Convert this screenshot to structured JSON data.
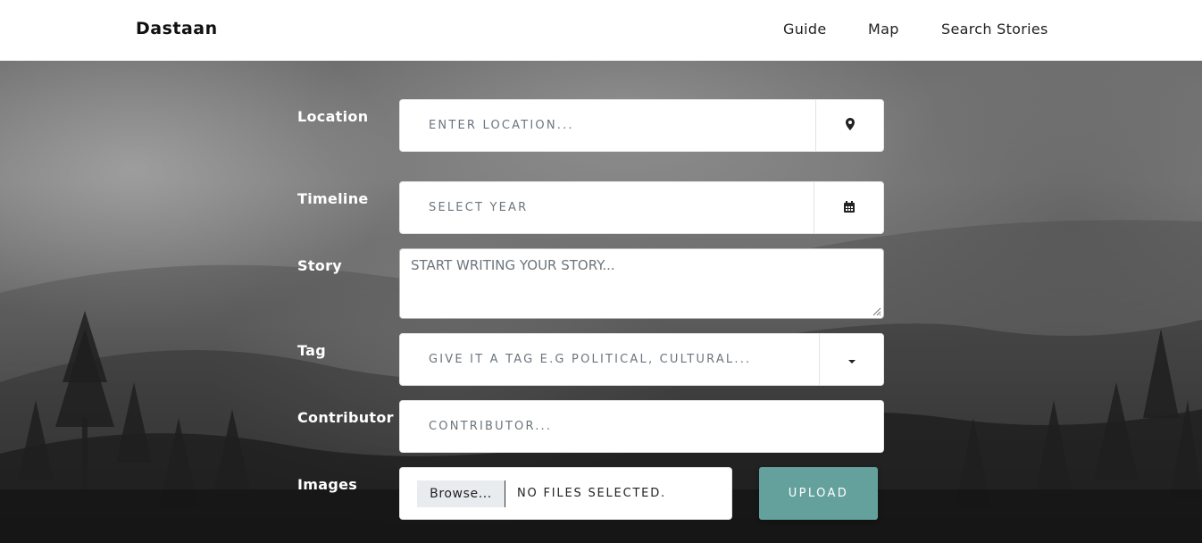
{
  "navbar": {
    "brand": "Dastaan",
    "links": [
      "Guide",
      "Map",
      "Search Stories"
    ]
  },
  "form": {
    "location": {
      "label": "Location",
      "placeholder": "ENTER LOCATION...",
      "icon": "map-marker-icon"
    },
    "timeline": {
      "label": "Timeline",
      "placeholder": "SELECT YEAR",
      "icon": "calendar-icon"
    },
    "story": {
      "label": "Story",
      "placeholder": "START WRITING YOUR STORY..."
    },
    "tag": {
      "label": "Tag",
      "placeholder": "GIVE IT A TAG E.G POLITICAL, CULTURAL...",
      "icon": "caret-down-icon"
    },
    "contributor": {
      "label": "Contributor",
      "placeholder": "CONTRIBUTOR..."
    },
    "images": {
      "label": "Images",
      "browse_label": "Browse...",
      "file_status": "NO FILES SELECTED."
    },
    "upload_label": "UPLOAD"
  },
  "colors": {
    "accent": "#64a19d",
    "navbar_bg": "#ffffff",
    "label_text": "#ffffff"
  }
}
